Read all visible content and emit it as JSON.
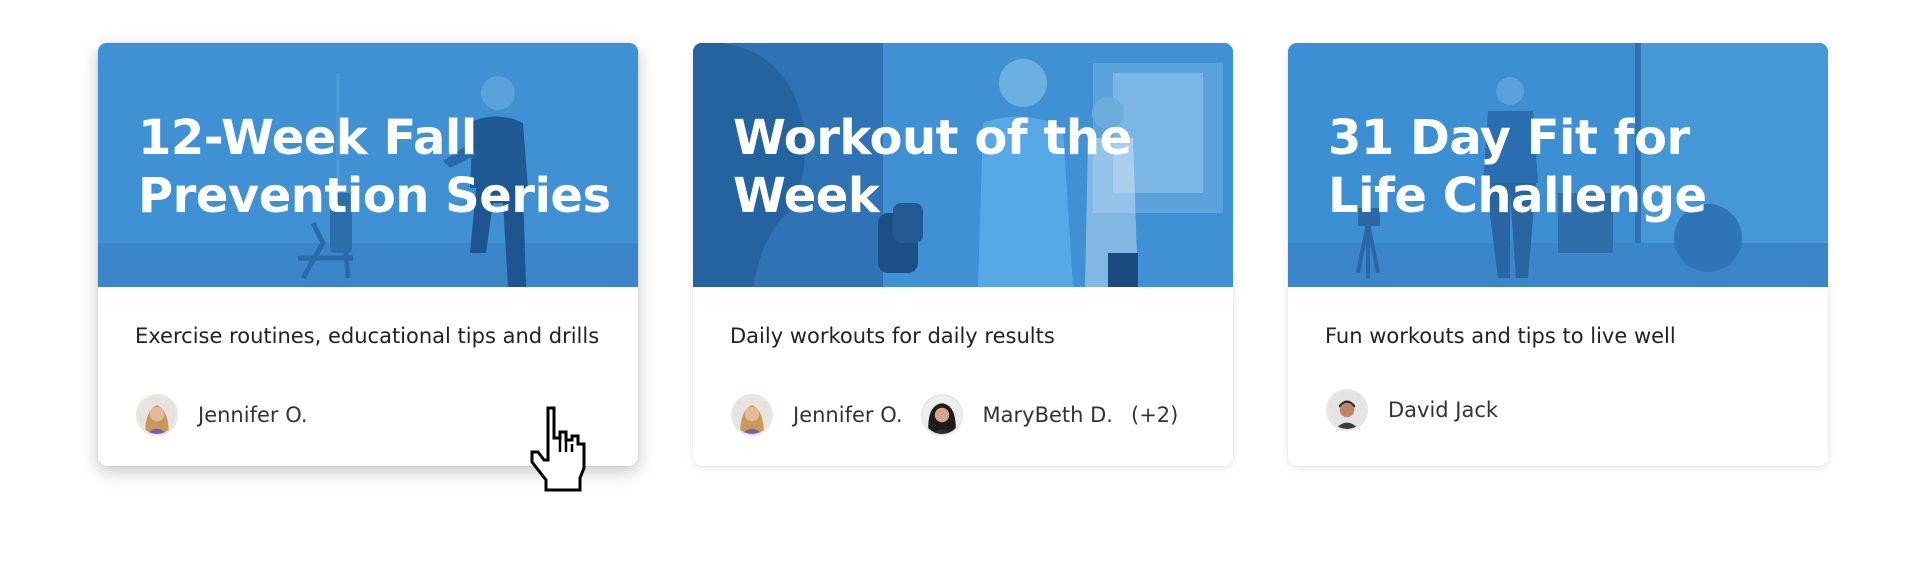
{
  "colors": {
    "banner_blue": "#3d8fd3",
    "banner_dark": "#2a6fb0",
    "text_dark": "#222222",
    "card_bg": "#ffffff"
  },
  "cards": [
    {
      "title": "12-Week Fall Prevention Series",
      "description": "Exercise routines, educational tips and drills",
      "authors": [
        {
          "name": "Jennifer O.",
          "avatar_icon": "woman-blonde-avatar"
        }
      ],
      "more": "",
      "hovered": true
    },
    {
      "title": "Workout of the Week",
      "description": "Daily workouts for daily results",
      "authors": [
        {
          "name": "Jennifer O.",
          "avatar_icon": "woman-blonde-avatar"
        },
        {
          "name": "MaryBeth D.",
          "avatar_icon": "woman-dark-hair-avatar"
        }
      ],
      "more": "(+2)",
      "hovered": false
    },
    {
      "title": "31 Day Fit for Life Challenge",
      "description": "Fun workouts and tips to live well",
      "authors": [
        {
          "name": "David Jack",
          "avatar_icon": "man-avatar"
        }
      ],
      "more": "",
      "hovered": false
    }
  ],
  "cursor": {
    "icon": "hand-pointer-icon"
  }
}
